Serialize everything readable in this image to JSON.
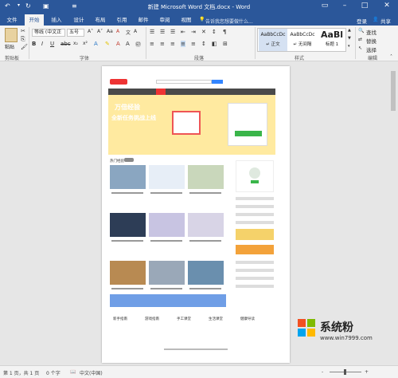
{
  "window": {
    "title": "新建 Microsoft Word 文档.docx - Word"
  },
  "quick_access": {
    "undo_icon": "undo-icon",
    "redo_icon": "redo-icon",
    "save_icon": "save-icon"
  },
  "tabs": [
    {
      "label": "文件"
    },
    {
      "label": "开始"
    },
    {
      "label": "插入"
    },
    {
      "label": "设计"
    },
    {
      "label": "布局"
    },
    {
      "label": "引用"
    },
    {
      "label": "邮件"
    },
    {
      "label": "审阅"
    },
    {
      "label": "视图"
    }
  ],
  "tell_me": "告诉我您想要做什么...",
  "account": {
    "login": "登录",
    "share": "共享"
  },
  "ribbon": {
    "paste_label": "粘贴",
    "clipboard_label": "剪贴板",
    "font_name": "等线 (中文正",
    "font_size": "五号",
    "font_label": "字体",
    "para_label": "段落",
    "styles_label": "样式",
    "styles": [
      {
        "preview": "AaBbCcDc",
        "name": "↵ 正文"
      },
      {
        "preview": "AaBbCcDc",
        "name": "↵ 无间隔"
      },
      {
        "preview": "AaBl",
        "name": "标题 1"
      }
    ],
    "find": "查找",
    "replace": "替换",
    "select": "选择",
    "edit_label": "编辑"
  },
  "page": {
    "hero_text_1": "万倍经验",
    "hero_text_2": "全新任务挑战上线",
    "section_label": "热门经验",
    "footer_cols": [
      "新手指南",
      "游戏指南",
      "手工课堂",
      "生活课堂",
      "健康导读"
    ]
  },
  "status": {
    "page": "第 1 页，共 1 页",
    "words": "0 个字",
    "lang": "中文(中国)",
    "zoom_minus": "-",
    "zoom_plus": "+"
  },
  "watermark": {
    "brand": "系统粉",
    "url": "www.win7999.com"
  },
  "colors": {
    "word_blue": "#2b579a",
    "ribbon_bg": "#f3f3f3"
  }
}
